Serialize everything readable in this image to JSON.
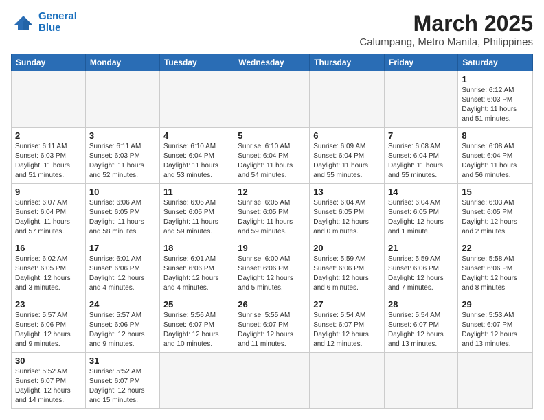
{
  "logo": {
    "line1": "General",
    "line2": "Blue"
  },
  "title": "March 2025",
  "location": "Calumpang, Metro Manila, Philippines",
  "weekdays": [
    "Sunday",
    "Monday",
    "Tuesday",
    "Wednesday",
    "Thursday",
    "Friday",
    "Saturday"
  ],
  "weeks": [
    [
      {
        "day": "",
        "info": ""
      },
      {
        "day": "",
        "info": ""
      },
      {
        "day": "",
        "info": ""
      },
      {
        "day": "",
        "info": ""
      },
      {
        "day": "",
        "info": ""
      },
      {
        "day": "",
        "info": ""
      },
      {
        "day": "1",
        "info": "Sunrise: 6:12 AM\nSunset: 6:03 PM\nDaylight: 11 hours\nand 51 minutes."
      }
    ],
    [
      {
        "day": "2",
        "info": "Sunrise: 6:11 AM\nSunset: 6:03 PM\nDaylight: 11 hours\nand 51 minutes."
      },
      {
        "day": "3",
        "info": "Sunrise: 6:11 AM\nSunset: 6:03 PM\nDaylight: 11 hours\nand 52 minutes."
      },
      {
        "day": "4",
        "info": "Sunrise: 6:10 AM\nSunset: 6:04 PM\nDaylight: 11 hours\nand 53 minutes."
      },
      {
        "day": "5",
        "info": "Sunrise: 6:10 AM\nSunset: 6:04 PM\nDaylight: 11 hours\nand 54 minutes."
      },
      {
        "day": "6",
        "info": "Sunrise: 6:09 AM\nSunset: 6:04 PM\nDaylight: 11 hours\nand 55 minutes."
      },
      {
        "day": "7",
        "info": "Sunrise: 6:08 AM\nSunset: 6:04 PM\nDaylight: 11 hours\nand 55 minutes."
      },
      {
        "day": "8",
        "info": "Sunrise: 6:08 AM\nSunset: 6:04 PM\nDaylight: 11 hours\nand 56 minutes."
      }
    ],
    [
      {
        "day": "9",
        "info": "Sunrise: 6:07 AM\nSunset: 6:04 PM\nDaylight: 11 hours\nand 57 minutes."
      },
      {
        "day": "10",
        "info": "Sunrise: 6:06 AM\nSunset: 6:05 PM\nDaylight: 11 hours\nand 58 minutes."
      },
      {
        "day": "11",
        "info": "Sunrise: 6:06 AM\nSunset: 6:05 PM\nDaylight: 11 hours\nand 59 minutes."
      },
      {
        "day": "12",
        "info": "Sunrise: 6:05 AM\nSunset: 6:05 PM\nDaylight: 11 hours\nand 59 minutes."
      },
      {
        "day": "13",
        "info": "Sunrise: 6:04 AM\nSunset: 6:05 PM\nDaylight: 12 hours\nand 0 minutes."
      },
      {
        "day": "14",
        "info": "Sunrise: 6:04 AM\nSunset: 6:05 PM\nDaylight: 12 hours\nand 1 minute."
      },
      {
        "day": "15",
        "info": "Sunrise: 6:03 AM\nSunset: 6:05 PM\nDaylight: 12 hours\nand 2 minutes."
      }
    ],
    [
      {
        "day": "16",
        "info": "Sunrise: 6:02 AM\nSunset: 6:05 PM\nDaylight: 12 hours\nand 3 minutes."
      },
      {
        "day": "17",
        "info": "Sunrise: 6:01 AM\nSunset: 6:06 PM\nDaylight: 12 hours\nand 4 minutes."
      },
      {
        "day": "18",
        "info": "Sunrise: 6:01 AM\nSunset: 6:06 PM\nDaylight: 12 hours\nand 4 minutes."
      },
      {
        "day": "19",
        "info": "Sunrise: 6:00 AM\nSunset: 6:06 PM\nDaylight: 12 hours\nand 5 minutes."
      },
      {
        "day": "20",
        "info": "Sunrise: 5:59 AM\nSunset: 6:06 PM\nDaylight: 12 hours\nand 6 minutes."
      },
      {
        "day": "21",
        "info": "Sunrise: 5:59 AM\nSunset: 6:06 PM\nDaylight: 12 hours\nand 7 minutes."
      },
      {
        "day": "22",
        "info": "Sunrise: 5:58 AM\nSunset: 6:06 PM\nDaylight: 12 hours\nand 8 minutes."
      }
    ],
    [
      {
        "day": "23",
        "info": "Sunrise: 5:57 AM\nSunset: 6:06 PM\nDaylight: 12 hours\nand 9 minutes."
      },
      {
        "day": "24",
        "info": "Sunrise: 5:57 AM\nSunset: 6:06 PM\nDaylight: 12 hours\nand 9 minutes."
      },
      {
        "day": "25",
        "info": "Sunrise: 5:56 AM\nSunset: 6:07 PM\nDaylight: 12 hours\nand 10 minutes."
      },
      {
        "day": "26",
        "info": "Sunrise: 5:55 AM\nSunset: 6:07 PM\nDaylight: 12 hours\nand 11 minutes."
      },
      {
        "day": "27",
        "info": "Sunrise: 5:54 AM\nSunset: 6:07 PM\nDaylight: 12 hours\nand 12 minutes."
      },
      {
        "day": "28",
        "info": "Sunrise: 5:54 AM\nSunset: 6:07 PM\nDaylight: 12 hours\nand 13 minutes."
      },
      {
        "day": "29",
        "info": "Sunrise: 5:53 AM\nSunset: 6:07 PM\nDaylight: 12 hours\nand 13 minutes."
      }
    ],
    [
      {
        "day": "30",
        "info": "Sunrise: 5:52 AM\nSunset: 6:07 PM\nDaylight: 12 hours\nand 14 minutes."
      },
      {
        "day": "31",
        "info": "Sunrise: 5:52 AM\nSunset: 6:07 PM\nDaylight: 12 hours\nand 15 minutes."
      },
      {
        "day": "",
        "info": ""
      },
      {
        "day": "",
        "info": ""
      },
      {
        "day": "",
        "info": ""
      },
      {
        "day": "",
        "info": ""
      },
      {
        "day": "",
        "info": ""
      }
    ]
  ]
}
